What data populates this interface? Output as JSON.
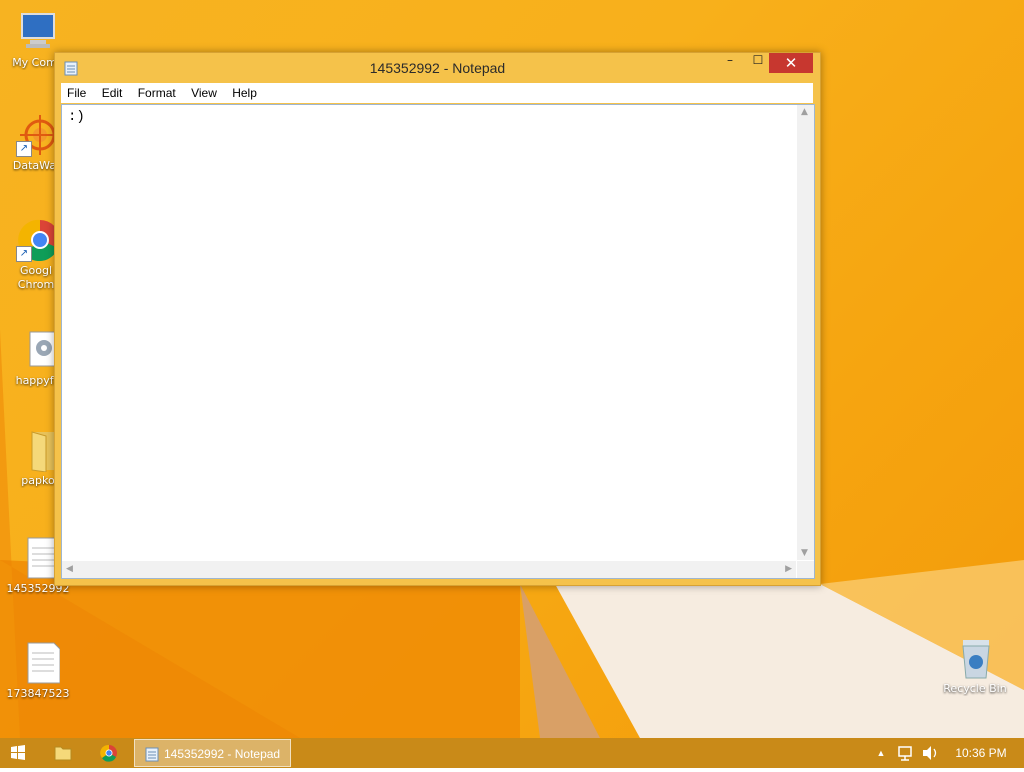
{
  "desktop": {
    "icons": [
      {
        "label": "My Comp",
        "icon": "computer-icon"
      },
      {
        "label": "DataWag",
        "icon": "starburst-app-icon"
      },
      {
        "label": "Googl Chrom",
        "icon": "chrome-icon"
      },
      {
        "label": "happyfa",
        "icon": "settings-file-icon"
      },
      {
        "label": "papko",
        "icon": "folder-icon"
      },
      {
        "label": "145352992",
        "icon": "text-file-icon"
      },
      {
        "label": "173847523",
        "icon": "text-file-icon"
      },
      {
        "label": "Recycle Bin",
        "icon": "recycle-bin-icon"
      }
    ]
  },
  "window": {
    "title": "145352992 - Notepad",
    "controls": {
      "minimize": "–",
      "maximize": "☐",
      "close": "✕"
    },
    "menu": [
      "File",
      "Edit",
      "Format",
      "View",
      "Help"
    ],
    "content": ":)"
  },
  "taskbar": {
    "notepad_label": "145352992 - Notepad",
    "clock": "10:36 PM",
    "colors": {
      "taskbar": "#c98a18",
      "close": "#c7372f"
    }
  }
}
